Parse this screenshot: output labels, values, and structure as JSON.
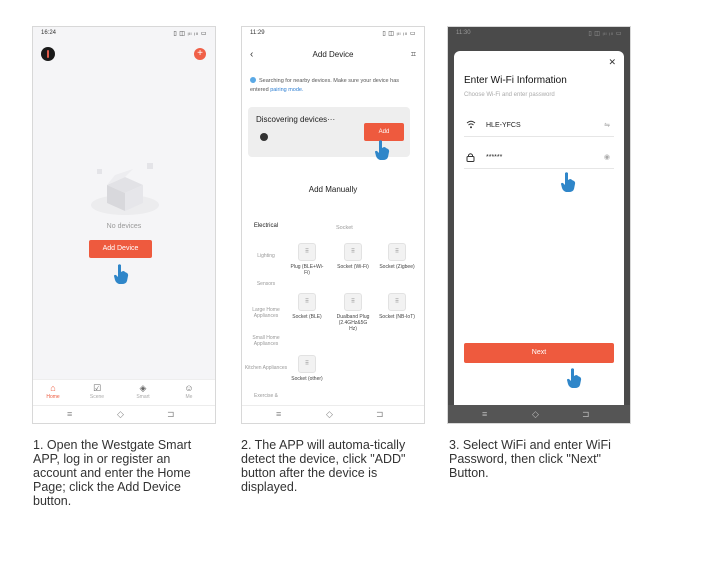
{
  "colors": {
    "accent": "#ee5a3e",
    "link": "#2d7fd3",
    "hand": "#2f86c9"
  },
  "step1": {
    "status_time": "16:24",
    "status_icons": "▯ ◫ ᵢₗₗ ᵢₗₗ ▭",
    "empty_text": "No devices",
    "add_device_label": "Add Device",
    "tabs": [
      {
        "label": "Home",
        "icon": "home-icon"
      },
      {
        "label": "Scene",
        "icon": "checkbox-icon"
      },
      {
        "label": "Smart",
        "icon": "shield-icon"
      },
      {
        "label": "Me",
        "icon": "person-icon"
      }
    ]
  },
  "step2": {
    "status_time": "11:29",
    "status_icons": "▯ ◫ ᵢₗₗ ᵢₗₗ ▭",
    "title": "Add Device",
    "search_text": "Searching for nearby devices. Make sure your device has entered",
    "search_link": "pairing mode.",
    "discovering": "Discovering devices···",
    "add_label": "Add",
    "manual_title": "Add Manually",
    "categories": [
      "Electrical",
      "Lighting",
      "Sensors",
      "Large Home Appliances",
      "Small Home Appliances",
      "Kitchen Appliances",
      "Exercise &"
    ],
    "subcategory": "Socket",
    "devices": [
      {
        "label": "Plug (BLE+Wi-Fi)"
      },
      {
        "label": "Socket (Wi-Fi)"
      },
      {
        "label": "Socket (Zigbee)"
      },
      {
        "label": "Socket (BLE)"
      },
      {
        "label": "Dualband Plug (2.4GHz&5G Hz)"
      },
      {
        "label": "Socket (NB-IoT)"
      },
      {
        "label": "Socket (other)"
      }
    ]
  },
  "step3": {
    "status_time": "11:30",
    "status_icons": "▯ ◫ ᵢₗₗ ᵢₗₗ ▭",
    "title": "Enter Wi-Fi Information",
    "subtitle": "Choose Wi-Fi and enter password",
    "wifi_name": "HLE-YFCS",
    "password": "******",
    "next_label": "Next"
  },
  "captions": [
    "1. Open the Westgate Smart APP, log in or register an account and enter the Home Page; click the Add Device button.",
    "2. The APP will automa-tically detect the device, click \"ADD\" button after the device is displayed.",
    "3. Select WiFi and enter WiFi Password, then click \"Next\" Button."
  ]
}
